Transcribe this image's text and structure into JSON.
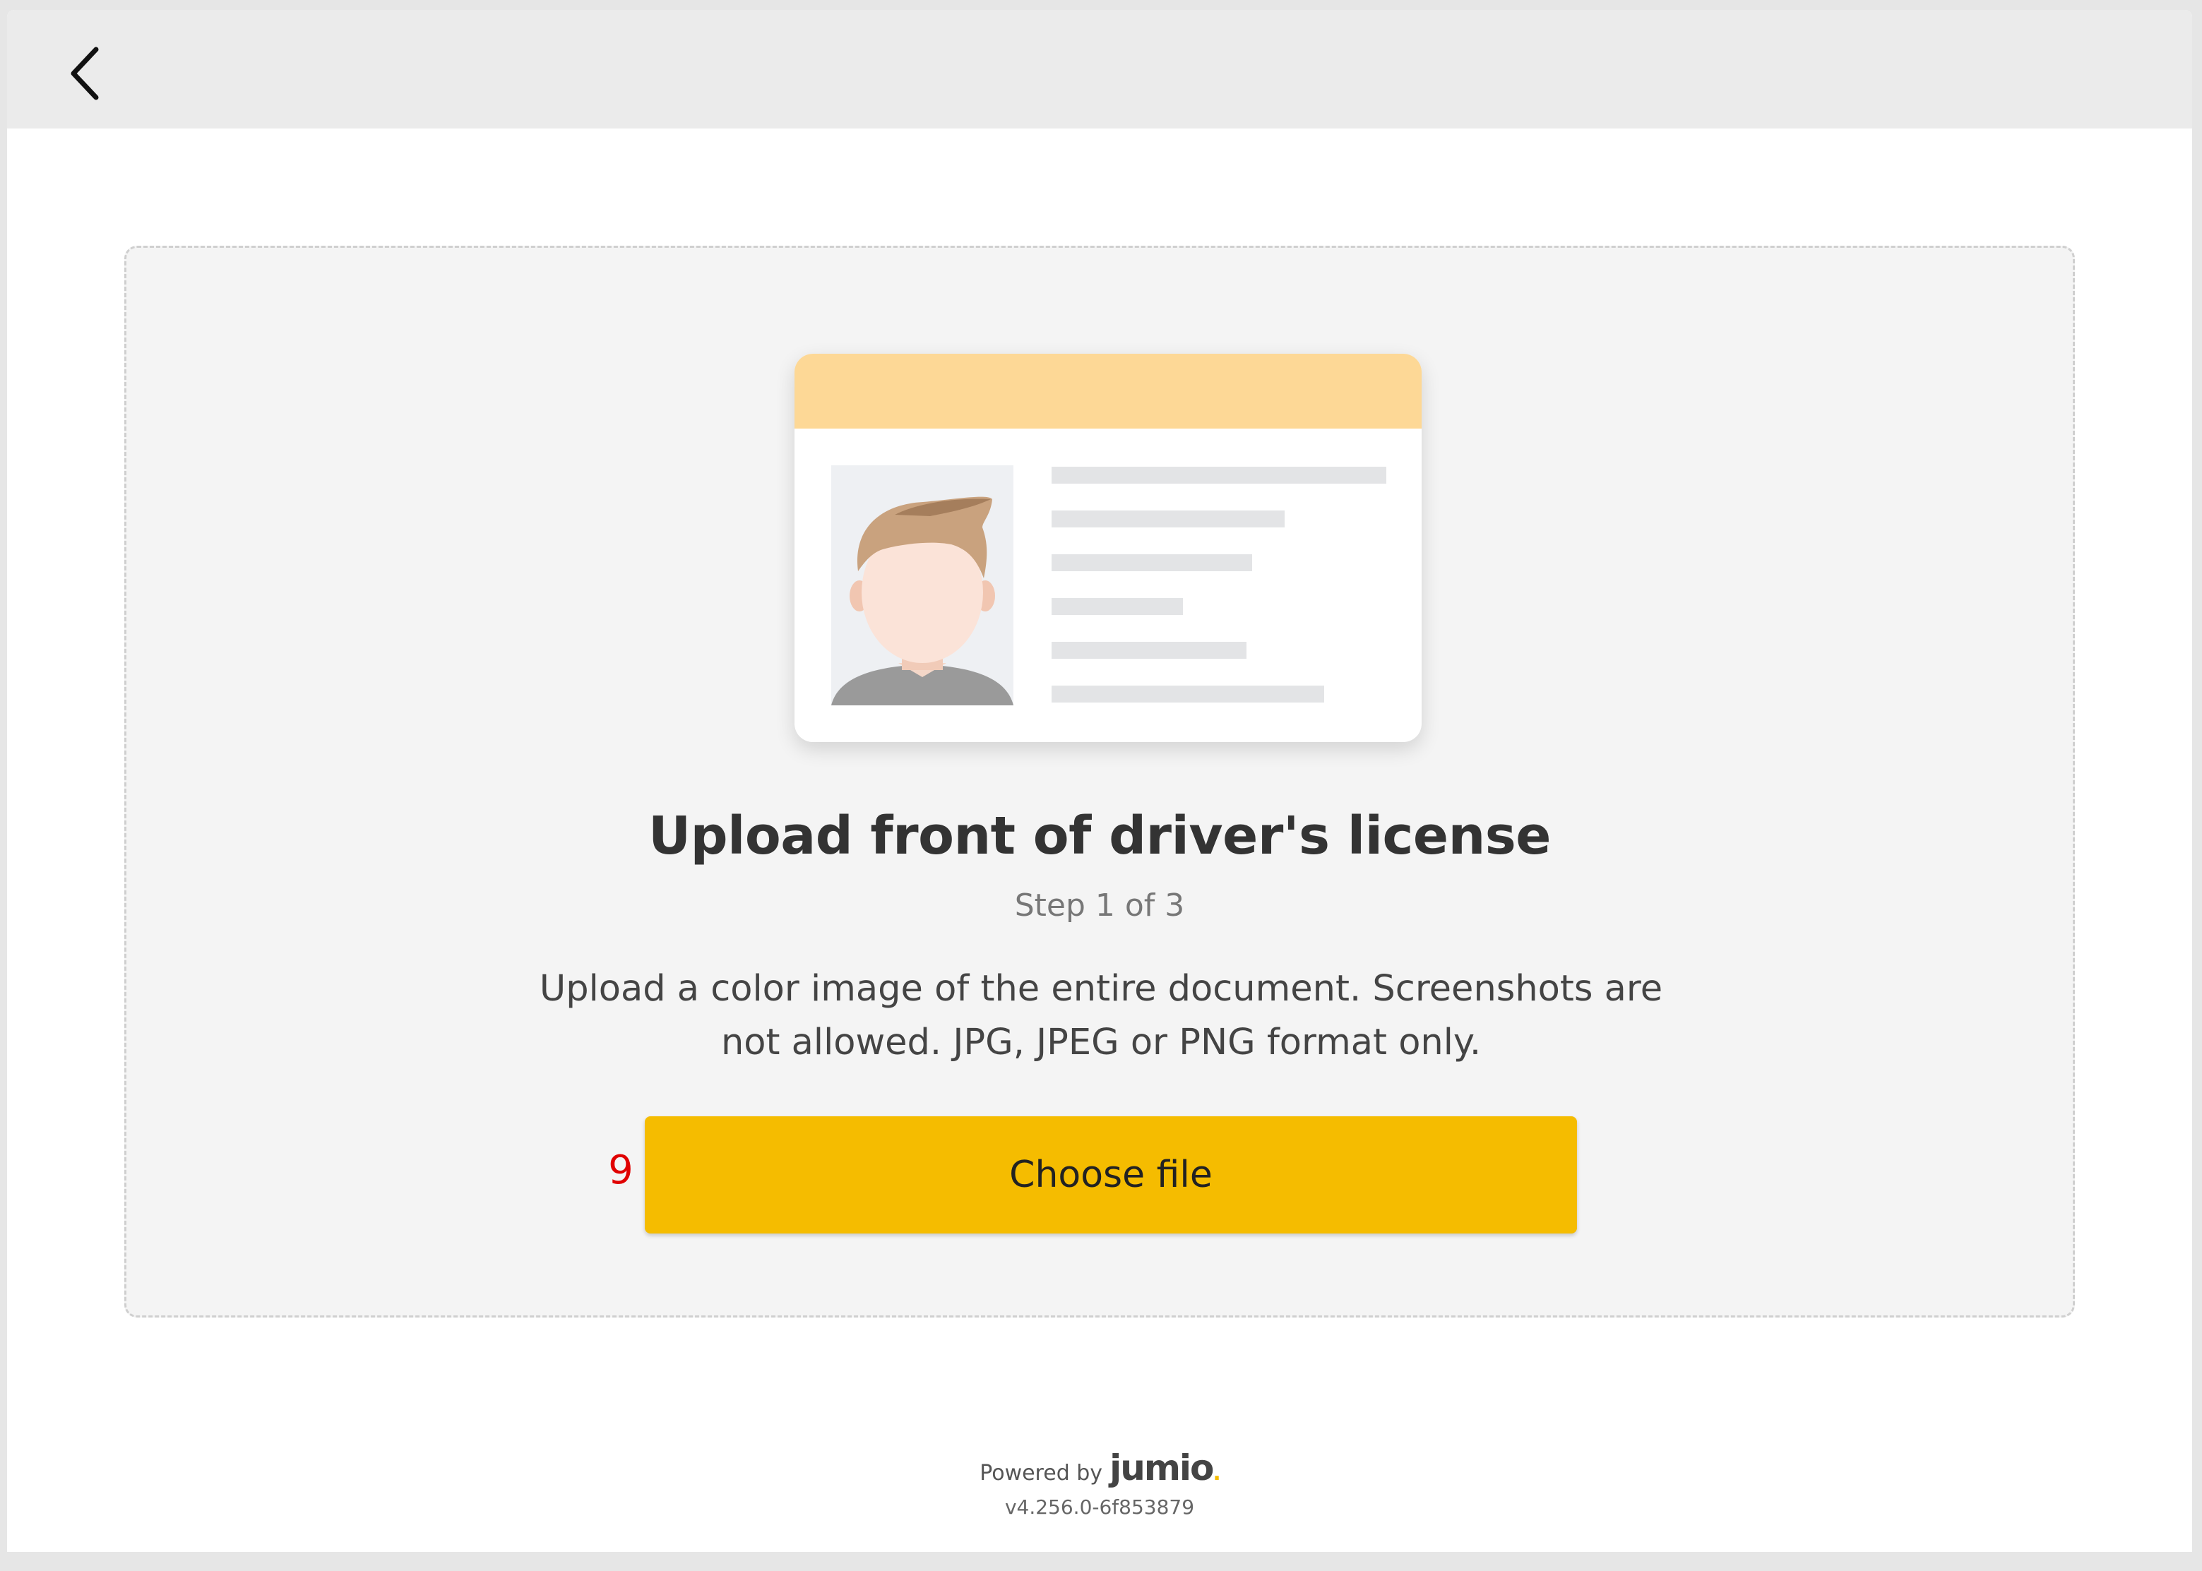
{
  "header": {
    "back_icon": "chevron-left-icon"
  },
  "upload": {
    "illustration_icon": "id-card-icon",
    "title": "Upload front of driver's license",
    "step": "Step 1 of 3",
    "description": "Upload a color image of the entire document. Screenshots are not allowed. JPG, JPEG or PNG format only.",
    "marker": "9",
    "choose_file_label": "Choose file",
    "accent_color": "#f5bc00",
    "card_header_color": "#fdd896"
  },
  "footer": {
    "powered_by": "Powered by",
    "brand": "jumio",
    "version": "v4.256.0-6f853879"
  }
}
